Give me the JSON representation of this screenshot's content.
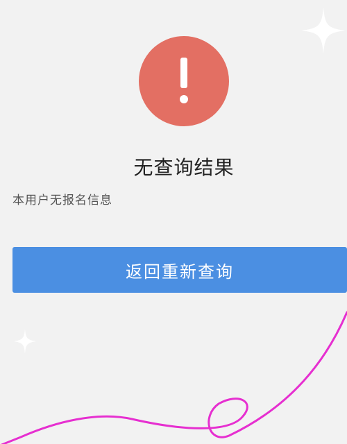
{
  "result": {
    "title": "无查询结果",
    "description": "本用户无报名信息"
  },
  "actions": {
    "retry_label": "返回重新查询"
  },
  "icons": {
    "alert": "exclamation-icon",
    "sparkle": "sparkle-icon"
  },
  "colors": {
    "alert_circle": "#e36f63",
    "button": "#4b8fe2",
    "doodle": "#e62fd0",
    "background": "#f2f2f2"
  }
}
